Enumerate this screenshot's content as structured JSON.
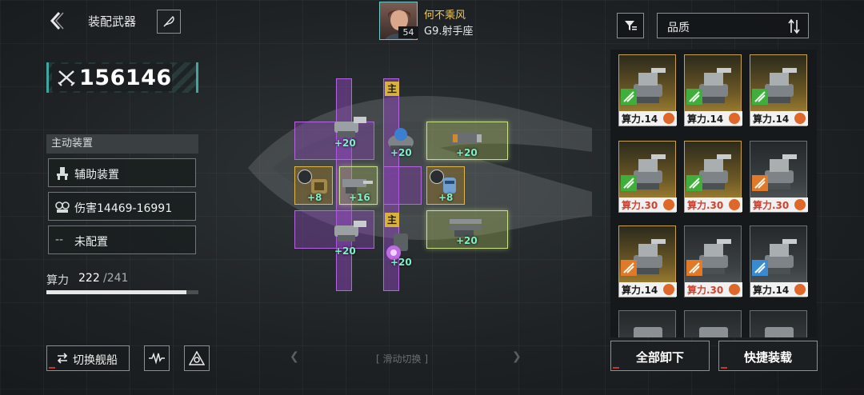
{
  "header": {
    "title": "装配武器",
    "pilot": {
      "name": "何不乘风",
      "level": "54",
      "class": "G9.射手座"
    },
    "sort": {
      "label": "品质"
    }
  },
  "left_panel": {
    "power_value": "156146",
    "section_title": "主动装置",
    "cards": [
      {
        "label": "辅助装置",
        "icon": "support-device-icon"
      },
      {
        "label": "伤害14469-16991",
        "icon": "damage-icon"
      },
      {
        "dash": "--",
        "label": "未配置"
      }
    ],
    "compute": {
      "label": "算力",
      "used": "222",
      "total": "/241",
      "fill_fraction": 0.921
    },
    "switch_ship_label": "切换舰船"
  },
  "grid": {
    "main_tag": "主",
    "bonuses": [
      "+20",
      "+20",
      "+20",
      "+8",
      "+16",
      "+8",
      "+20",
      "+20",
      "+20"
    ]
  },
  "swipe_hint": "滑动切换",
  "inventory": {
    "items": [
      {
        "cost": "算力.14",
        "rarity": "gold",
        "tier": "green"
      },
      {
        "cost": "算力.14",
        "rarity": "gold",
        "tier": "green"
      },
      {
        "cost": "算力.14",
        "rarity": "gold",
        "tier": "green"
      },
      {
        "cost": "算力.30",
        "rarity": "gold",
        "tier": "green"
      },
      {
        "cost": "算力.30",
        "rarity": "gold",
        "tier": "green"
      },
      {
        "cost": "算力.30",
        "rarity": "gray",
        "tier": "orange"
      },
      {
        "cost": "算力.14",
        "rarity": "gold",
        "tier": "orange"
      },
      {
        "cost": "算力.30",
        "rarity": "gray",
        "tier": "orange"
      },
      {
        "cost": "算力.14",
        "rarity": "gray",
        "tier": "blue"
      }
    ]
  },
  "buttons": {
    "unequip_all": "全部卸下",
    "quick_equip": "快捷装载"
  },
  "colors": {
    "accent_teal": "#3fa6a0",
    "pilot_name": "#f2c84b",
    "bonus_text": "#7ff0c8",
    "slot_purple": "#b466e0",
    "slot_green": "#c9e08a",
    "cost_red": "#d4402c"
  }
}
